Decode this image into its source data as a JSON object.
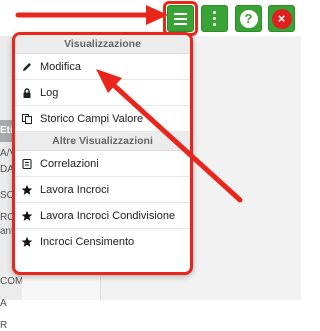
{
  "toolbar": {
    "help_label": "?",
    "close_label": "×",
    "icons": {
      "menu": "hamburger-icon",
      "more": "kebab-icon",
      "help": "help-icon",
      "close": "close-icon"
    }
  },
  "sidebar": {
    "header_label": "Eti",
    "items": [
      "A/VE",
      "DAB",
      "SO",
      "RO",
      "anti",
      "COM",
      "A",
      "R"
    ]
  },
  "menu": {
    "section1_title": "Visualizzazione",
    "section1_items": [
      {
        "label": "Modifica",
        "icon": "pencil-icon"
      },
      {
        "label": "Log",
        "icon": "lock-icon"
      },
      {
        "label": "Storico Campi Valore",
        "icon": "copy-icon"
      }
    ],
    "section2_title": "Altre Visualizzazioni",
    "section2_items": [
      {
        "label": "Correlazioni",
        "icon": "list-icon"
      },
      {
        "label": "Lavora Incroci",
        "icon": "star-icon"
      },
      {
        "label": "Lavora Incroci Condivisione",
        "icon": "star-icon"
      },
      {
        "label": "Incroci Censimento",
        "icon": "star-icon"
      }
    ]
  },
  "colors": {
    "accent_green": "#3aa335",
    "annotation_red": "#e8261c",
    "close_red": "#e02020"
  }
}
